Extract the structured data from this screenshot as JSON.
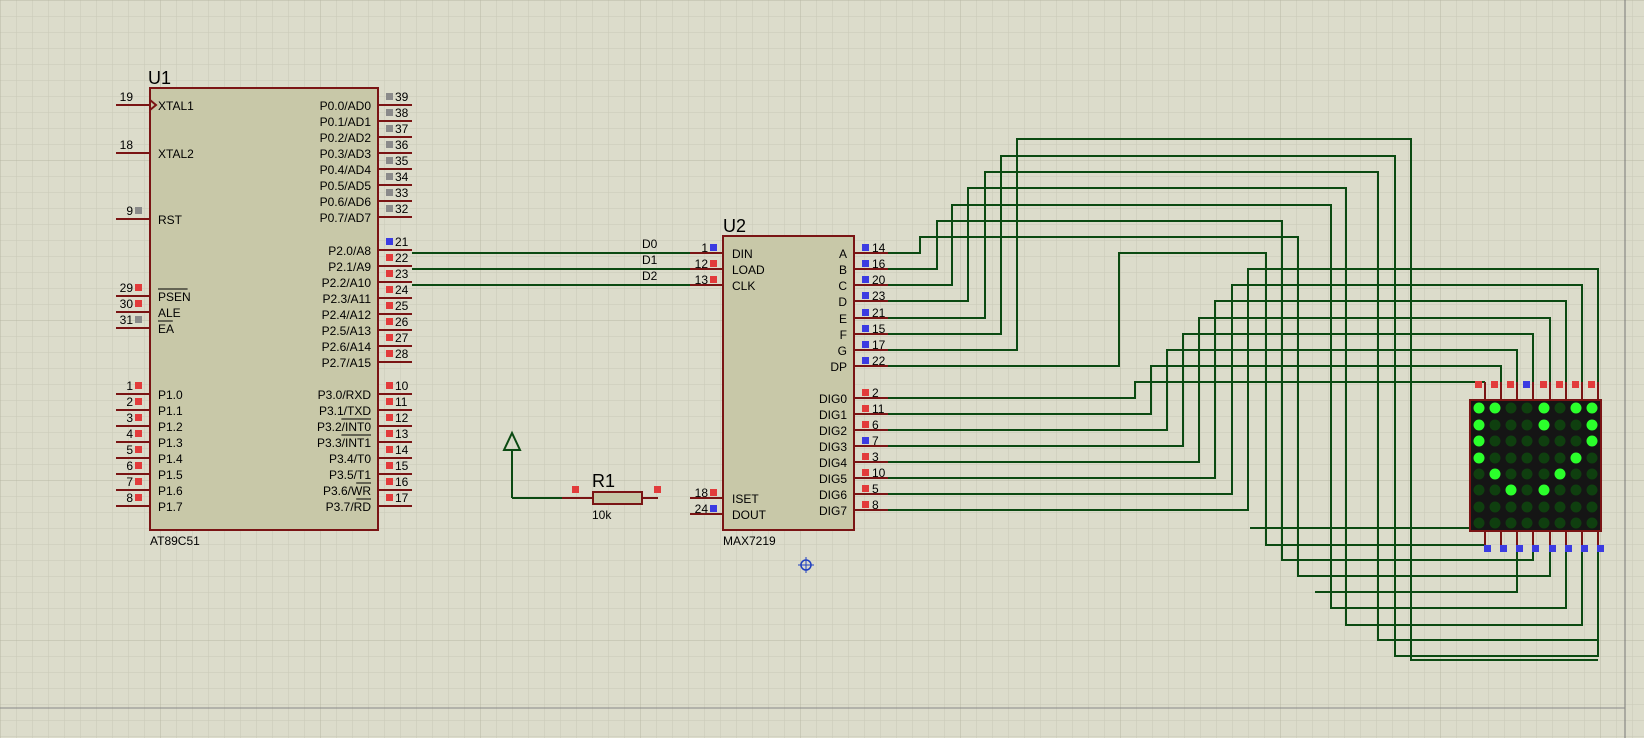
{
  "u1": {
    "ref": "U1",
    "part": "AT89C51",
    "left_pins": [
      {
        "num": "19",
        "name": "XTAL1",
        "kind": "clock",
        "dot": "none"
      },
      {
        "num": "18",
        "name": "XTAL2",
        "kind": "normal",
        "dot": "none"
      },
      {
        "num": "9",
        "name": "RST",
        "kind": "normal",
        "dot": "gray"
      },
      {
        "num": "29",
        "name": "PSEN",
        "kind": "overbar",
        "dot": "red"
      },
      {
        "num": "30",
        "name": "ALE",
        "kind": "normal",
        "dot": "red"
      },
      {
        "num": "31",
        "name": "EA",
        "kind": "overbar",
        "dot": "gray"
      },
      {
        "num": "1",
        "name": "P1.0",
        "kind": "normal",
        "dot": "red"
      },
      {
        "num": "2",
        "name": "P1.1",
        "kind": "normal",
        "dot": "red"
      },
      {
        "num": "3",
        "name": "P1.2",
        "kind": "normal",
        "dot": "red"
      },
      {
        "num": "4",
        "name": "P1.3",
        "kind": "normal",
        "dot": "red"
      },
      {
        "num": "5",
        "name": "P1.4",
        "kind": "normal",
        "dot": "red"
      },
      {
        "num": "6",
        "name": "P1.5",
        "kind": "normal",
        "dot": "red"
      },
      {
        "num": "7",
        "name": "P1.6",
        "kind": "normal",
        "dot": "red"
      },
      {
        "num": "8",
        "name": "P1.7",
        "kind": "normal",
        "dot": "red"
      }
    ],
    "right_pins": [
      {
        "num": "39",
        "name": "P0.0/AD0",
        "dot": "gray"
      },
      {
        "num": "38",
        "name": "P0.1/AD1",
        "dot": "gray"
      },
      {
        "num": "37",
        "name": "P0.2/AD2",
        "dot": "gray"
      },
      {
        "num": "36",
        "name": "P0.3/AD3",
        "dot": "gray"
      },
      {
        "num": "35",
        "name": "P0.4/AD4",
        "dot": "gray"
      },
      {
        "num": "34",
        "name": "P0.5/AD5",
        "dot": "gray"
      },
      {
        "num": "33",
        "name": "P0.6/AD6",
        "dot": "gray"
      },
      {
        "num": "32",
        "name": "P0.7/AD7",
        "dot": "gray"
      },
      {
        "num": "21",
        "name": "P2.0/A8",
        "dot": "blue"
      },
      {
        "num": "22",
        "name": "P2.1/A9",
        "dot": "red"
      },
      {
        "num": "23",
        "name": "P2.2/A10",
        "dot": "red"
      },
      {
        "num": "24",
        "name": "P2.3/A11",
        "dot": "red"
      },
      {
        "num": "25",
        "name": "P2.4/A12",
        "dot": "red"
      },
      {
        "num": "26",
        "name": "P2.5/A13",
        "dot": "red"
      },
      {
        "num": "27",
        "name": "P2.6/A14",
        "dot": "red"
      },
      {
        "num": "28",
        "name": "P2.7/A15",
        "dot": "red"
      },
      {
        "num": "10",
        "name": "P3.0/RXD",
        "dot": "red"
      },
      {
        "num": "11",
        "name": "P3.1/TXD",
        "dot": "red"
      },
      {
        "num": "12",
        "name": "P3.2/INT0",
        "dot": "red",
        "bar": "INT0"
      },
      {
        "num": "13",
        "name": "P3.3/INT1",
        "dot": "red",
        "bar": "INT1"
      },
      {
        "num": "14",
        "name": "P3.4/T0",
        "dot": "red"
      },
      {
        "num": "15",
        "name": "P3.5/T1",
        "dot": "red"
      },
      {
        "num": "16",
        "name": "P3.6/WR",
        "dot": "red",
        "bar": "WR"
      },
      {
        "num": "17",
        "name": "P3.7/RD",
        "dot": "red",
        "bar": "RD"
      }
    ]
  },
  "u2": {
    "ref": "U2",
    "part": "MAX7219",
    "left_pins": [
      {
        "num": "1",
        "name": "DIN",
        "dot": "blue"
      },
      {
        "num": "12",
        "name": "LOAD",
        "dot": "red"
      },
      {
        "num": "13",
        "name": "CLK",
        "dot": "red"
      },
      {
        "num": "18",
        "name": "ISET",
        "dot": "red"
      },
      {
        "num": "24",
        "name": "DOUT",
        "dot": "blue"
      }
    ],
    "right_pins": [
      {
        "num": "14",
        "name": "A",
        "dot": "blue"
      },
      {
        "num": "16",
        "name": "B",
        "dot": "blue"
      },
      {
        "num": "20",
        "name": "C",
        "dot": "blue"
      },
      {
        "num": "23",
        "name": "D",
        "dot": "blue"
      },
      {
        "num": "21",
        "name": "E",
        "dot": "blue"
      },
      {
        "num": "15",
        "name": "F",
        "dot": "blue"
      },
      {
        "num": "17",
        "name": "G",
        "dot": "blue"
      },
      {
        "num": "22",
        "name": "DP",
        "dot": "blue"
      },
      {
        "num": "2",
        "name": "DIG0",
        "dot": "red"
      },
      {
        "num": "11",
        "name": "DIG1",
        "dot": "red"
      },
      {
        "num": "6",
        "name": "DIG2",
        "dot": "red"
      },
      {
        "num": "7",
        "name": "DIG3",
        "dot": "blue"
      },
      {
        "num": "3",
        "name": "DIG4",
        "dot": "red"
      },
      {
        "num": "10",
        "name": "DIG5",
        "dot": "red"
      },
      {
        "num": "5",
        "name": "DIG6",
        "dot": "red"
      },
      {
        "num": "8",
        "name": "DIG7",
        "dot": "red"
      }
    ]
  },
  "net_labels": [
    "D0",
    "D1",
    "D2"
  ],
  "r1": {
    "ref": "R1",
    "value": "10k"
  },
  "matrix": {
    "top_pin_dots": [
      "red",
      "red",
      "red",
      "blue",
      "red",
      "red",
      "red",
      "red"
    ],
    "bottom_pin_dots": [
      "blue",
      "blue",
      "blue",
      "blue",
      "blue",
      "blue",
      "blue",
      "blue"
    ],
    "leds": [
      [
        1,
        1,
        0,
        0,
        1,
        0,
        1,
        1
      ],
      [
        1,
        0,
        0,
        0,
        1,
        0,
        0,
        1
      ],
      [
        1,
        0,
        0,
        0,
        0,
        0,
        0,
        1
      ],
      [
        1,
        0,
        0,
        0,
        0,
        0,
        1,
        0
      ],
      [
        0,
        1,
        0,
        0,
        0,
        1,
        0,
        0
      ],
      [
        0,
        0,
        1,
        0,
        1,
        0,
        0,
        0
      ],
      [
        0,
        0,
        0,
        0,
        0,
        0,
        0,
        0
      ],
      [
        0,
        0,
        0,
        0,
        0,
        0,
        0,
        0
      ]
    ]
  },
  "colors": {
    "background": "#dcdccb",
    "grid_minor": "#c8c8b6",
    "grid_major": "#b9b9a6",
    "component_body": "#c8c8a8",
    "component_outline": "#7a1414",
    "wire": "#0b4a12",
    "text": "#000000",
    "pin_red": "#e23b3b",
    "pin_blue": "#3b3be2",
    "pin_gray": "#8a8a8a",
    "led_on": "#2bff2b",
    "led_off": "#0f3f0f",
    "matrix_body": "#151515"
  }
}
